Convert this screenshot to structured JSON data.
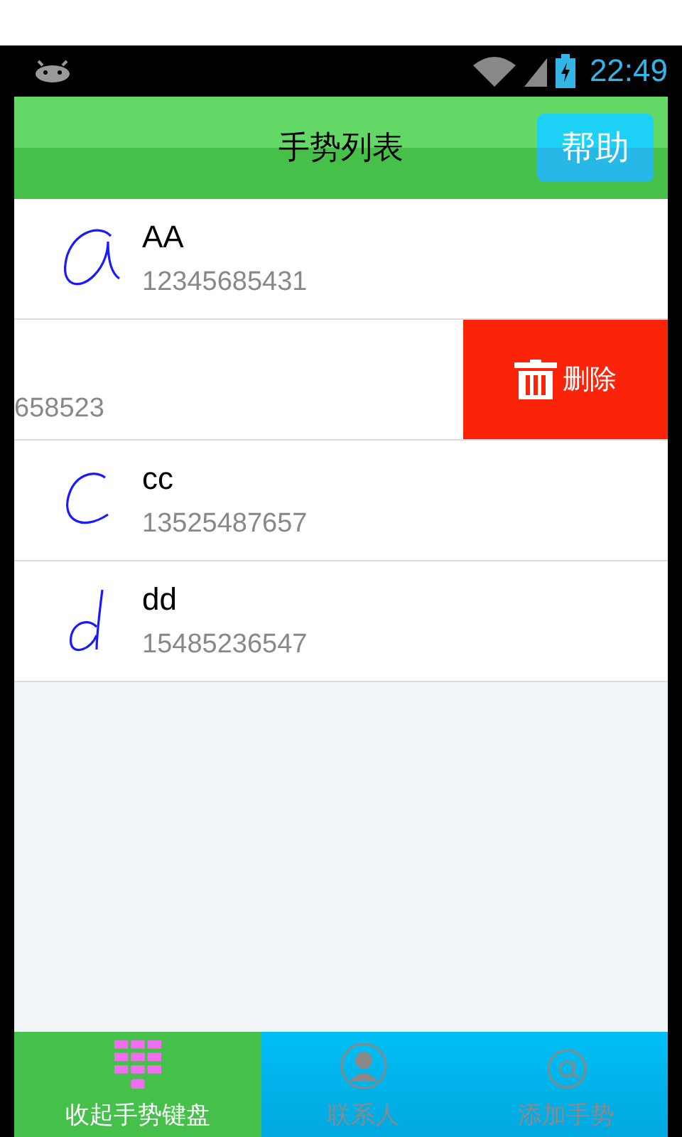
{
  "status_bar": {
    "time": "22:49"
  },
  "header": {
    "title": "手势列表",
    "help_button": "帮助"
  },
  "rows": [
    {
      "name": "AA",
      "number": "12345685431",
      "swiped": false
    },
    {
      "number": "658523",
      "swiped": true,
      "delete_button": "删除"
    },
    {
      "name": "cc",
      "number": "13525487657",
      "swiped": false
    },
    {
      "name": "dd",
      "number": "15485236547",
      "swiped": false
    }
  ],
  "tabs": [
    {
      "label": "收起手势键盘",
      "selected": true
    },
    {
      "label": "联系人",
      "selected": false
    },
    {
      "label": "添加手势",
      "selected": false
    }
  ]
}
